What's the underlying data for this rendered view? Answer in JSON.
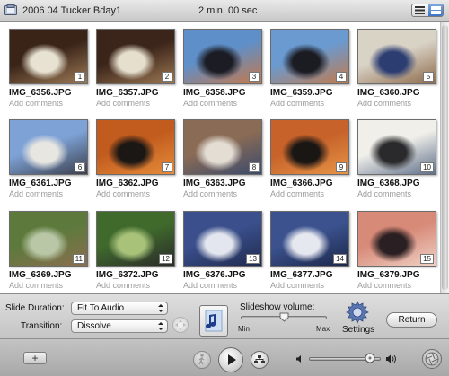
{
  "window": {
    "album_title": "2006 04 Tucker Bday1",
    "duration": "2 min, 00 sec"
  },
  "photos": [
    {
      "filename": "IMG_6356.JPG",
      "comment": "Add comments",
      "number": "1",
      "colors": [
        "#3a2418",
        "#e8e2d2",
        "#9d7a56"
      ]
    },
    {
      "filename": "IMG_6357.JPG",
      "comment": "Add comments",
      "number": "2",
      "colors": [
        "#3b2419",
        "#e6dfce",
        "#9c7853"
      ]
    },
    {
      "filename": "IMG_6358.JPG",
      "comment": "Add comments",
      "number": "3",
      "colors": [
        "#5f8fc8",
        "#1c1c24",
        "#c6784a"
      ]
    },
    {
      "filename": "IMG_6359.JPG",
      "comment": "Add comments",
      "number": "4",
      "colors": [
        "#6a9ad0",
        "#1b1b22",
        "#c17a4c"
      ]
    },
    {
      "filename": "IMG_6360.JPG",
      "comment": "Add comments",
      "number": "5",
      "colors": [
        "#d9d3c6",
        "#2c3d72",
        "#8e6b4c"
      ]
    },
    {
      "filename": "IMG_6361.JPG",
      "comment": "Add comments",
      "number": "6",
      "colors": [
        "#7ea2d6",
        "#e8e6e0",
        "#3b3f4c"
      ]
    },
    {
      "filename": "IMG_6362.JPG",
      "comment": "Add comments",
      "number": "7",
      "colors": [
        "#c25c1e",
        "#1b1714",
        "#e58c3a"
      ]
    },
    {
      "filename": "IMG_6363.JPG",
      "comment": "Add comments",
      "number": "8",
      "colors": [
        "#8a6b55",
        "#e3ddd4",
        "#3a4a6c"
      ]
    },
    {
      "filename": "IMG_6366.JPG",
      "comment": "Add comments",
      "number": "9",
      "colors": [
        "#c6622a",
        "#191614",
        "#e79446"
      ]
    },
    {
      "filename": "IMG_6368.JPG",
      "comment": "Add comments",
      "number": "10",
      "colors": [
        "#f0efea",
        "#2a2a2c",
        "#5f6f8a"
      ]
    },
    {
      "filename": "IMG_6369.JPG",
      "comment": "Add comments",
      "number": "11",
      "colors": [
        "#5d7a3c",
        "#b9c7a6",
        "#8a6d4f"
      ]
    },
    {
      "filename": "IMG_6372.JPG",
      "comment": "Add comments",
      "number": "12",
      "colors": [
        "#3f6a2c",
        "#a8c27a",
        "#2a2a2a"
      ]
    },
    {
      "filename": "IMG_6376.JPG",
      "comment": "Add comments",
      "number": "13",
      "colors": [
        "#3a4f8c",
        "#e3e6ee",
        "#1f2a4e"
      ]
    },
    {
      "filename": "IMG_6377.JPG",
      "comment": "Add comments",
      "number": "14",
      "colors": [
        "#3b528e",
        "#e6e8ef",
        "#1c274a"
      ]
    },
    {
      "filename": "IMG_6379.JPG",
      "comment": "Add comments",
      "number": "15",
      "colors": [
        "#d88a78",
        "#2a1f22",
        "#eed0c4"
      ]
    }
  ],
  "toolbar": {
    "slide_duration_label": "Slide Duration:",
    "slide_duration_value": "Fit To Audio",
    "transition_label": "Transition:",
    "transition_value": "Dissolve",
    "volume_label": "Slideshow volume:",
    "volume_min": "Min",
    "volume_max": "Max",
    "volume_level": 0.5,
    "settings_label": "Settings",
    "return_label": "Return"
  },
  "bottombar": {
    "add_label": "+",
    "playback_volume_level": 0.85
  },
  "icons": {
    "album": "album-icon",
    "view_toggle": "view-toggle-icon",
    "music": "music-note-icon",
    "settings": "gear-icon",
    "walk": "walking-person-icon",
    "play": "play-icon",
    "share": "share-icon",
    "speaker_low": "speaker-low-icon",
    "speaker_high": "speaker-high-icon",
    "aperture": "aperture-icon"
  }
}
